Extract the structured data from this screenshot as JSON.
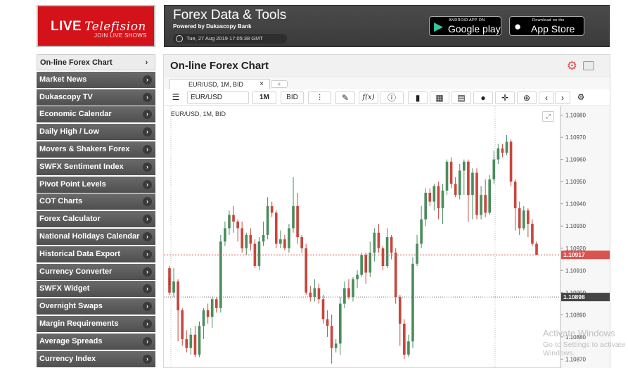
{
  "logo": {
    "word1": "LIVE",
    "word2": "Telefision",
    "tagline": "JOIN LIVE SHOWS"
  },
  "header": {
    "title": "Forex Data & Tools",
    "subtitle": "Powered by Dukascopy Bank",
    "datetime": "Tue, 27 Aug 2019 17:05:38 GMT",
    "google_small": "ANDROID APP ON",
    "google_big": "Google play",
    "apple_small": "Download on the",
    "apple_big": "App Store"
  },
  "sidebar": {
    "items": [
      {
        "label": "On-line Forex Chart"
      },
      {
        "label": "Market News"
      },
      {
        "label": "Dukascopy TV"
      },
      {
        "label": "Economic Calendar"
      },
      {
        "label": "Daily High / Low"
      },
      {
        "label": "Movers & Shakers Forex"
      },
      {
        "label": "SWFX Sentiment Index"
      },
      {
        "label": "Pivot Point Levels"
      },
      {
        "label": "COT Charts"
      },
      {
        "label": "Forex Calculator"
      },
      {
        "label": "National Holidays Calendar"
      },
      {
        "label": "Historical Data Export"
      },
      {
        "label": "Currency Converter"
      },
      {
        "label": "SWFX Widget"
      },
      {
        "label": "Overnight Swaps"
      },
      {
        "label": "Margin Requirements"
      },
      {
        "label": "Average Spreads"
      },
      {
        "label": "Currency Index"
      }
    ]
  },
  "panel": {
    "title": "On-line Forex Chart",
    "tab_label": "EUR/USD, 1M, BID",
    "tab_close": "×",
    "tab_add": "+",
    "instrument": "EUR/USD",
    "period": "1M",
    "side": "BID",
    "chart_label": "EUR/USD, 1M, BID"
  },
  "colors": {
    "up": "#4a8c5c",
    "down": "#c8463d",
    "accent": "#d4121a"
  },
  "watermark": {
    "line1": "Activate Windows",
    "line2": "Go to Settings to activate Windows."
  },
  "chart_data": {
    "type": "candlestick",
    "title": "EUR/USD, 1M, BID",
    "y_ticks": [
      1.1098,
      1.1097,
      1.1096,
      1.1095,
      1.1094,
      1.1093,
      1.1092,
      1.1091,
      1.109,
      1.1089,
      1.1088,
      1.1087
    ],
    "ylim": [
      1.10866,
      1.10984
    ],
    "price_marker": 1.10917,
    "price_marker2": 1.10898,
    "candles": [
      [
        1.10911,
        1.109,
        1.10912,
        1.10899
      ],
      [
        1.109,
        1.10905,
        1.10911,
        1.10898
      ],
      [
        1.10905,
        1.10892,
        1.10906,
        1.10878
      ],
      [
        1.10892,
        1.10879,
        1.10893,
        1.10876
      ],
      [
        1.10879,
        1.10875,
        1.10883,
        1.10873
      ],
      [
        1.10875,
        1.10881,
        1.10884,
        1.10872
      ],
      [
        1.10881,
        1.10872,
        1.10885,
        1.10871
      ],
      [
        1.10872,
        1.10885,
        1.10887,
        1.10871
      ],
      [
        1.10885,
        1.10892,
        1.10893,
        1.10879
      ],
      [
        1.10892,
        1.10889,
        1.10895,
        1.10886
      ],
      [
        1.10889,
        1.10897,
        1.10898,
        1.10884
      ],
      [
        1.10897,
        1.10893,
        1.10898,
        1.10891
      ],
      [
        1.10893,
        1.10923,
        1.10926,
        1.10891
      ],
      [
        1.10923,
        1.10929,
        1.10932,
        1.10921
      ],
      [
        1.10929,
        1.10935,
        1.10937,
        1.10926
      ],
      [
        1.10935,
        1.10932,
        1.10939,
        1.10927
      ],
      [
        1.10932,
        1.10929,
        1.10933,
        1.10923
      ],
      [
        1.10929,
        1.1092,
        1.10932,
        1.10918
      ],
      [
        1.1092,
        1.10926,
        1.10927,
        1.10917
      ],
      [
        1.10926,
        1.10922,
        1.10929,
        1.10919
      ],
      [
        1.10922,
        1.10912,
        1.10924,
        1.10911
      ],
      [
        1.10912,
        1.10923,
        1.10925,
        1.1091
      ],
      [
        1.10923,
        1.10926,
        1.10932,
        1.10921
      ],
      [
        1.10926,
        1.10939,
        1.10943,
        1.10924
      ],
      [
        1.10939,
        1.10936,
        1.10941,
        1.10934
      ],
      [
        1.10936,
        1.10922,
        1.10937,
        1.1092
      ],
      [
        1.10922,
        1.10924,
        1.10928,
        1.1092
      ],
      [
        1.10924,
        1.1092,
        1.10926,
        1.10919
      ],
      [
        1.1092,
        1.10929,
        1.10931,
        1.10918
      ],
      [
        1.10929,
        1.10939,
        1.10952,
        1.10927
      ],
      [
        1.10939,
        1.10925,
        1.10945,
        1.10922
      ],
      [
        1.10925,
        1.1092,
        1.10926,
        1.10918
      ],
      [
        1.1092,
        1.109,
        1.10922,
        1.10899
      ],
      [
        1.109,
        1.10898,
        1.10903,
        1.10896
      ],
      [
        1.10898,
        1.10902,
        1.10906,
        1.10896
      ],
      [
        1.10902,
        1.10897,
        1.10904,
        1.10895
      ],
      [
        1.10897,
        1.10888,
        1.10899,
        1.10886
      ],
      [
        1.10888,
        1.10885,
        1.10892,
        1.1088
      ],
      [
        1.10885,
        1.10875,
        1.1089,
        1.10868
      ],
      [
        1.10875,
        1.10877,
        1.10879,
        1.10873
      ],
      [
        1.10877,
        1.10895,
        1.10898,
        1.10872
      ],
      [
        1.10895,
        1.10902,
        1.10905,
        1.10893
      ],
      [
        1.10902,
        1.10898,
        1.10906,
        1.10897
      ],
      [
        1.10898,
        1.10906,
        1.10907,
        1.10896
      ],
      [
        1.10906,
        1.10908,
        1.1091,
        1.10902
      ],
      [
        1.10908,
        1.10917,
        1.10918,
        1.10907
      ],
      [
        1.10917,
        1.10909,
        1.10918,
        1.10904
      ],
      [
        1.10909,
        1.10918,
        1.10923,
        1.10907
      ],
      [
        1.10918,
        1.10927,
        1.10929,
        1.10914
      ],
      [
        1.10927,
        1.1092,
        1.10931,
        1.10918
      ],
      [
        1.1092,
        1.10912,
        1.10921,
        1.1091
      ],
      [
        1.10912,
        1.10925,
        1.10929,
        1.10911
      ],
      [
        1.10925,
        1.10918,
        1.10926,
        1.10915
      ],
      [
        1.10918,
        1.10898,
        1.1092,
        1.10895
      ],
      [
        1.10898,
        1.10886,
        1.10899,
        1.10876
      ],
      [
        1.10886,
        1.10872,
        1.10888,
        1.1087
      ],
      [
        1.10872,
        1.10878,
        1.10881,
        1.10871
      ],
      [
        1.10878,
        1.10913,
        1.10916,
        1.10875
      ],
      [
        1.10913,
        1.10922,
        1.10926,
        1.10912
      ],
      [
        1.10922,
        1.10933,
        1.10939,
        1.1092
      ],
      [
        1.10933,
        1.10945,
        1.10947,
        1.1093
      ],
      [
        1.10945,
        1.10941,
        1.10947,
        1.10939
      ],
      [
        1.10941,
        1.10948,
        1.10949,
        1.10937
      ],
      [
        1.10948,
        1.10938,
        1.1095,
        1.10933
      ],
      [
        1.10938,
        1.10946,
        1.10949,
        1.10931
      ],
      [
        1.10946,
        1.10959,
        1.1096,
        1.10944
      ],
      [
        1.10959,
        1.10949,
        1.10961,
        1.10947
      ],
      [
        1.10949,
        1.10944,
        1.10952,
        1.10943
      ],
      [
        1.10944,
        1.10955,
        1.10958,
        1.10942
      ],
      [
        1.10955,
        1.10959,
        1.1096,
        1.10944
      ],
      [
        1.10959,
        1.10944,
        1.1096,
        1.10932
      ],
      [
        1.10944,
        1.10954,
        1.10956,
        1.10933
      ],
      [
        1.10954,
        1.10935,
        1.10956,
        1.10933
      ],
      [
        1.10935,
        1.10944,
        1.10948,
        1.10933
      ],
      [
        1.10944,
        1.10936,
        1.10951,
        1.10934
      ],
      [
        1.10936,
        1.10951,
        1.10953,
        1.10935
      ],
      [
        1.10951,
        1.1096,
        1.10964,
        1.10949
      ],
      [
        1.1096,
        1.10965,
        1.10967,
        1.10958
      ],
      [
        1.10965,
        1.10963,
        1.10967,
        1.10961
      ],
      [
        1.10963,
        1.10968,
        1.10971,
        1.10962
      ],
      [
        1.10968,
        1.1095,
        1.10969,
        1.10948
      ],
      [
        1.1095,
        1.10938,
        1.10951,
        1.10928
      ],
      [
        1.10938,
        1.10929,
        1.10941,
        1.10926
      ],
      [
        1.10929,
        1.10937,
        1.10939,
        1.10928
      ],
      [
        1.10937,
        1.10931,
        1.10938,
        1.10925
      ],
      [
        1.10931,
        1.10922,
        1.10933,
        1.10921
      ],
      [
        1.10922,
        1.10917,
        1.10923,
        1.10917
      ]
    ]
  }
}
